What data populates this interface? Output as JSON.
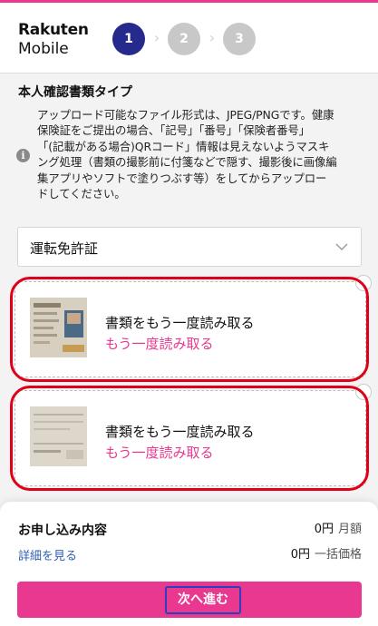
{
  "header": {
    "logo_line1": "Rakuten",
    "logo_line2": "Mobile",
    "steps": [
      "1",
      "2",
      "3"
    ],
    "active_step": 1
  },
  "section": {
    "title": "本人確認書類タイプ",
    "notice_lines": [
      "アップロード可能なファイル形式は、JPEG/PNGです。健康",
      "保険証をご提出の場合、「記号」「番号」「保険者番号」",
      "「(記載がある場合)QRコード」情報は見えないようマスキ",
      "ング処理（書類の撮影前に付箋などで隠す、撮影後に画像編",
      "集アプリやソフトで塗りつぶす等）をしてからアップロー",
      "ドしてください。"
    ]
  },
  "document_select": {
    "value": "運転免許証"
  },
  "cards": [
    {
      "title": "書類をもう一度読み取る",
      "link": "もう一度読み取る"
    },
    {
      "title": "書類をもう一度読み取る",
      "link": "もう一度読み取る"
    }
  ],
  "footer": {
    "title": "お申し込み内容",
    "details_link": "詳細を見る",
    "monthly_price": "0円",
    "monthly_unit": "月額",
    "lump_price": "0円",
    "lump_unit": "一括価格",
    "next_button": "次へ進む"
  },
  "colors": {
    "brand_pink": "#e8388f",
    "step_active": "#252a8c",
    "step_inactive": "#c8c8c8",
    "highlight_red": "#e0001a",
    "link_blue": "#2f5fb3"
  },
  "icons": {
    "info": "info-icon",
    "select_chevron": "chevron-down-icon",
    "step_chevron": "chevron-right-icon",
    "card_close": "close-icon"
  }
}
